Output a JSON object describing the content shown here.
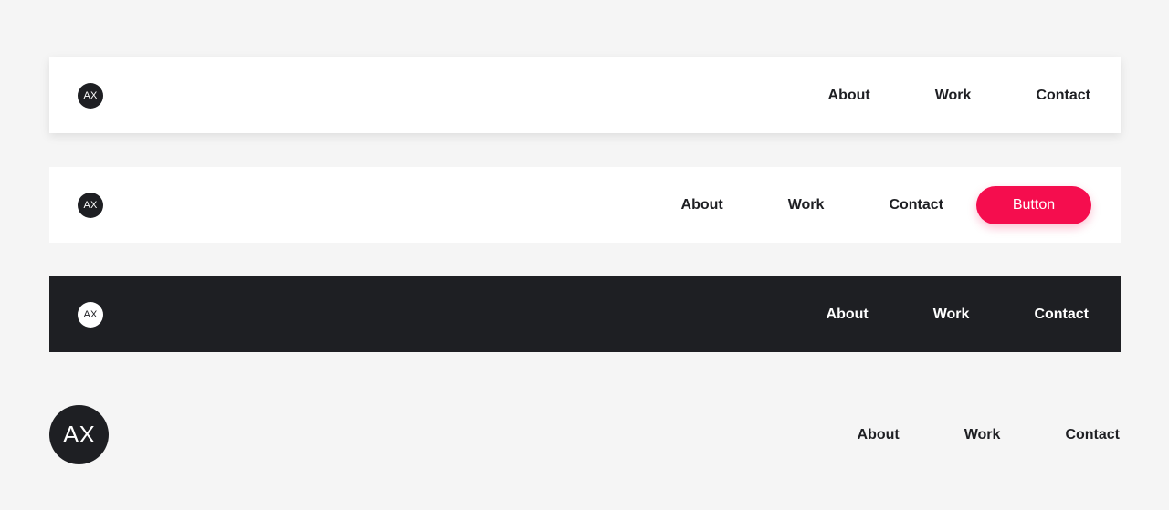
{
  "colors": {
    "background": "#f5f5f5",
    "surface": "#ffffff",
    "dark": "#1e1f23",
    "accent": "#f50d4e"
  },
  "navbars": [
    {
      "variant": "light-shadow",
      "logo": "AX",
      "links": [
        "About",
        "Work",
        "Contact"
      ]
    },
    {
      "variant": "light-with-button",
      "logo": "AX",
      "links": [
        "About",
        "Work",
        "Contact"
      ],
      "button": "Button"
    },
    {
      "variant": "dark",
      "logo": "AX",
      "links": [
        "About",
        "Work",
        "Contact"
      ]
    },
    {
      "variant": "transparent-large-logo",
      "logo": "AX",
      "links": [
        "About",
        "Work",
        "Contact"
      ]
    }
  ]
}
